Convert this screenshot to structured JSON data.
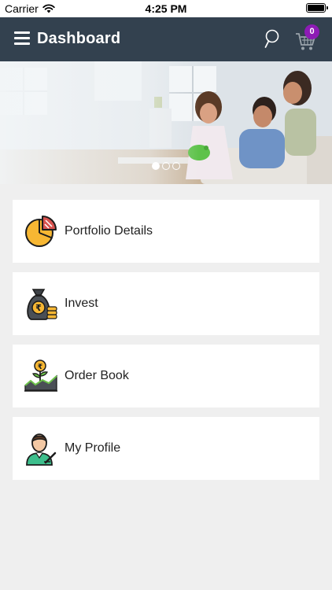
{
  "status_bar": {
    "carrier": "Carrier",
    "time": "4:25 PM"
  },
  "header": {
    "title": "Dashboard",
    "cart_count": "0"
  },
  "banner": {
    "slides": 3,
    "active_slide": 1
  },
  "menu": [
    {
      "label": "Portfolio Details",
      "icon": "pie-chart-icon"
    },
    {
      "label": "Invest",
      "icon": "money-bag-icon"
    },
    {
      "label": "Order Book",
      "icon": "growth-plant-icon"
    },
    {
      "label": "My Profile",
      "icon": "user-profile-icon"
    }
  ],
  "colors": {
    "header_bg": "#33414f",
    "badge_bg": "#8d1bb5",
    "page_bg": "#efefef",
    "accent": "#f5a623"
  }
}
